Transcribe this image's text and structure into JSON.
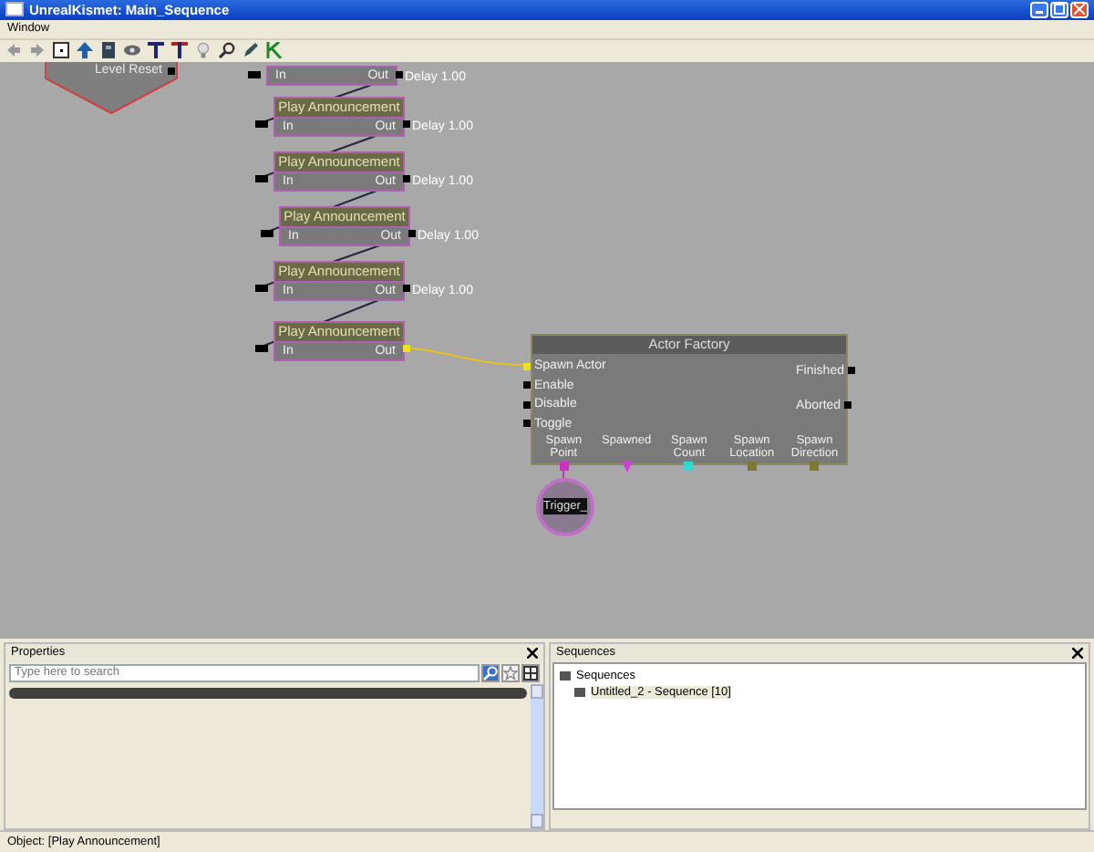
{
  "window": {
    "title": "UnrealKismet: Main_Sequence"
  },
  "menu": [
    "Window"
  ],
  "canvas": {
    "level_reset": {
      "label": "Level Reset"
    },
    "announcements": [
      {
        "in": "In",
        "out": "Out",
        "delay": "Delay 1.00"
      },
      {
        "title": "Play Announcement",
        "in": "In",
        "out": "Out",
        "delay": "Delay 1.00"
      },
      {
        "title": "Play Announcement",
        "in": "In",
        "out": "Out",
        "delay": "Delay 1.00"
      },
      {
        "title": "Play Announcement",
        "in": "In",
        "out": "Out",
        "delay": "Delay 1.00"
      },
      {
        "title": "Play Announcement",
        "in": "In",
        "out": "Out",
        "delay": "Delay 1.00"
      },
      {
        "title": "Play Announcement",
        "in": "In",
        "out": "Out"
      }
    ],
    "actor_factory": {
      "title": "Actor Factory",
      "inputs": [
        "Spawn Actor",
        "Enable",
        "Disable",
        "Toggle"
      ],
      "outputs": [
        "Finished",
        "Aborted"
      ],
      "variables": [
        {
          "label": "Spawn Point",
          "color": "#c832c8",
          "kind": "square"
        },
        {
          "label": "Spawned",
          "color": "#d040d8",
          "kind": "triangle"
        },
        {
          "label": "Spawn Count",
          "color": "#30d8d8",
          "kind": "square"
        },
        {
          "label": "Spawn Location",
          "color": "#7c7a2e",
          "kind": "square"
        },
        {
          "label": "Spawn Direction",
          "color": "#7c7a2e",
          "kind": "square"
        }
      ]
    },
    "trigger": {
      "label": "Trigger_"
    }
  },
  "properties": {
    "title": "Properties",
    "search": {
      "placeholder": "Type here to search"
    }
  },
  "sequences": {
    "title": "Sequences",
    "tree": [
      {
        "label": "Sequences",
        "children": [
          {
            "label": "Untitled_2 - Sequence [10]"
          }
        ]
      }
    ]
  },
  "status_bar": "Object: [Play Announcement]"
}
